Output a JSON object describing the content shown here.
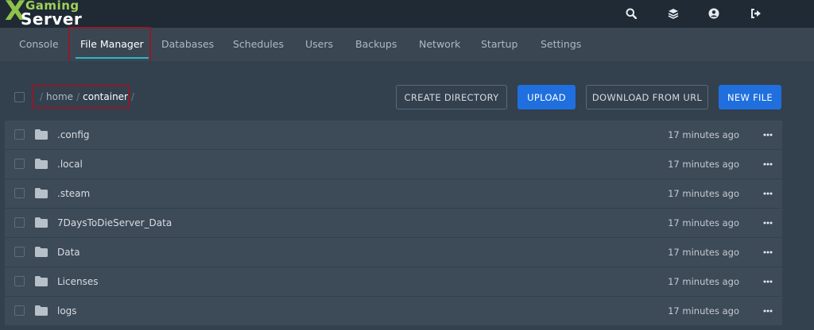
{
  "brand": {
    "line1": "Gaming",
    "line2": "Server",
    "mark": "X"
  },
  "header_icons": [
    "search-icon",
    "layers-icon",
    "account-icon",
    "logout-icon"
  ],
  "tabs": [
    {
      "label": "Console",
      "active": false
    },
    {
      "label": "File Manager",
      "active": true
    },
    {
      "label": "Databases",
      "active": false
    },
    {
      "label": "Schedules",
      "active": false
    },
    {
      "label": "Users",
      "active": false
    },
    {
      "label": "Backups",
      "active": false
    },
    {
      "label": "Network",
      "active": false
    },
    {
      "label": "Startup",
      "active": false
    },
    {
      "label": "Settings",
      "active": false
    }
  ],
  "breadcrumb": {
    "sep": "/",
    "root": "home",
    "current": "container"
  },
  "toolbar": {
    "create_directory": "CREATE DIRECTORY",
    "upload": "UPLOAD",
    "download_from_url": "DOWNLOAD FROM URL",
    "new_file": "NEW FILE"
  },
  "files": [
    {
      "name": ".config",
      "modified": "17 minutes ago"
    },
    {
      "name": ".local",
      "modified": "17 minutes ago"
    },
    {
      "name": ".steam",
      "modified": "17 minutes ago"
    },
    {
      "name": "7DaysToDieServer_Data",
      "modified": "17 minutes ago"
    },
    {
      "name": "Data",
      "modified": "17 minutes ago"
    },
    {
      "name": "Licenses",
      "modified": "17 minutes ago"
    },
    {
      "name": "logs",
      "modified": "17 minutes ago"
    }
  ],
  "colors": {
    "accent": "#1f6fde",
    "tab_underline": "#2fb6c5",
    "highlight_box": "#8b1c2c",
    "brand_green": "#8fc24a"
  }
}
